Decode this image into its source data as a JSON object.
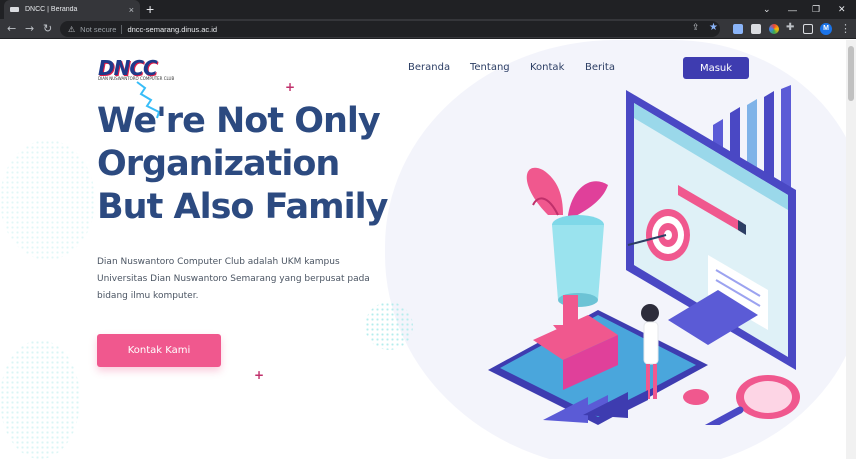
{
  "browser": {
    "tab_title": "DNCC | Beranda",
    "tab_close": "×",
    "new_tab": "+",
    "security_label": "Not secure",
    "url": "dncc-semarang.dinus.ac.id",
    "profile_initial": "M"
  },
  "logo": {
    "name": "DNCC",
    "tagline": "DIAN NUSWANTORO COMPUTER CLUB"
  },
  "nav": {
    "items": [
      "Beranda",
      "Tentang",
      "Kontak",
      "Berita"
    ],
    "login_label": "Masuk"
  },
  "hero": {
    "headline_line1": "We're Not Only",
    "headline_line2": "Organization",
    "headline_line3": "But Also Family",
    "description": "Dian Nuswantoro Computer Club adalah UKM kampus Universitas Dian Nuswantoro Semarang yang berpusat pada bidang ilmu komputer.",
    "cta_label": "Kontak Kami"
  },
  "colors": {
    "brand_navy": "#2c4a80",
    "login_button": "#3e3cb0",
    "cta_pink": "#f0588e",
    "accent_magenta": "#c0306b"
  },
  "icons": [
    "back-arrow-icon",
    "forward-arrow-icon",
    "reload-icon",
    "warning-icon",
    "share-icon",
    "star-icon",
    "extension-icon",
    "sidepanel-icon",
    "menu-dots-icon"
  ]
}
